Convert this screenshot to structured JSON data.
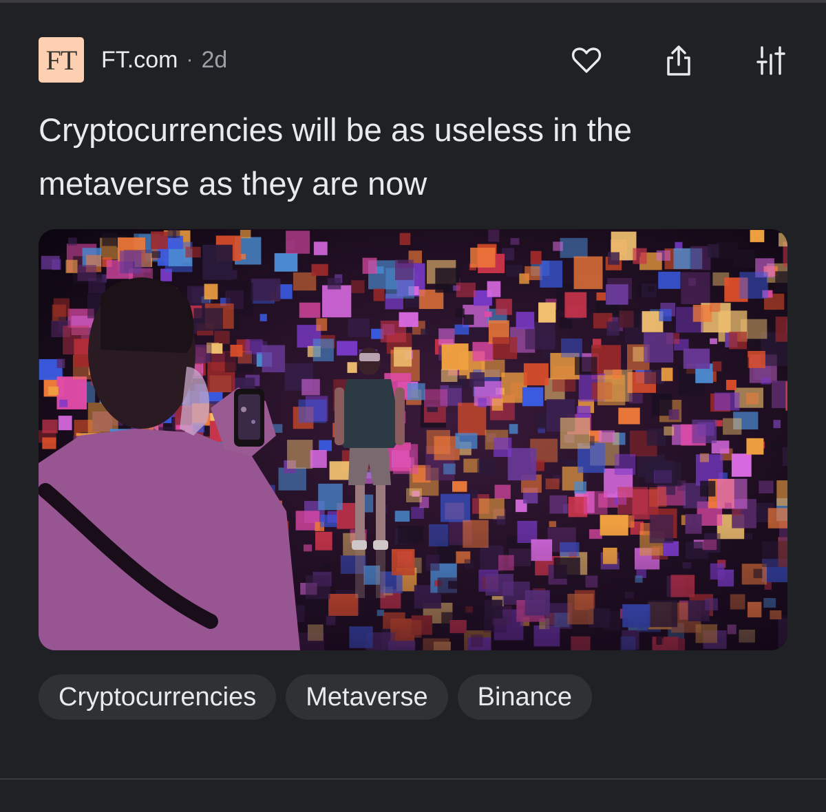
{
  "source": {
    "logo_text": "FT",
    "name": "FT.com",
    "separator": "·",
    "age": "2d"
  },
  "icons": {
    "like": "heart-icon",
    "share": "share-icon",
    "more": "adjust-icon"
  },
  "headline": "Cryptocurrencies will be as useless in the metaverse as they are now",
  "image": {
    "description_icon": "article-photo"
  },
  "chips": [
    {
      "label": "Cryptocurrencies"
    },
    {
      "label": "Metaverse"
    },
    {
      "label": "Binance"
    }
  ],
  "colors": {
    "background": "#202124",
    "text": "#e8eaed",
    "muted": "#9aa0a6",
    "chip": "#303134",
    "logo_bg": "#fcd0b1"
  }
}
